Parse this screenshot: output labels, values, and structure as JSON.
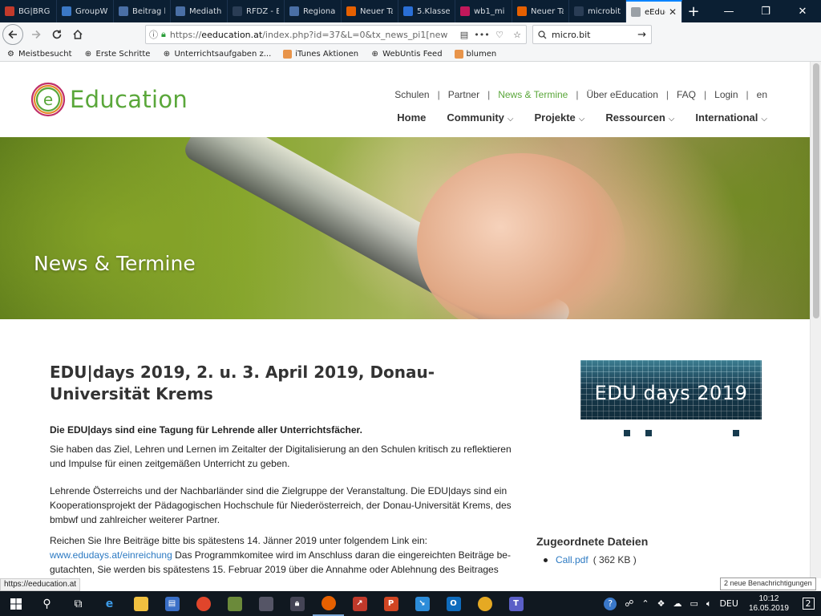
{
  "browser": {
    "tabs": [
      {
        "title": "BG|BRG V",
        "color": "#c23a2b"
      },
      {
        "title": "GroupW",
        "color": "#3b78c5"
      },
      {
        "title": "Beitrag b",
        "color": "#4a6fa5"
      },
      {
        "title": "Mediath",
        "color": "#4a6fa5"
      },
      {
        "title": "RFDZ - B",
        "color": "#2a3d55"
      },
      {
        "title": "Regional",
        "color": "#4a6fa5"
      },
      {
        "title": "Neuer Ta",
        "color": "#e66000"
      },
      {
        "title": "5.Klasse",
        "color": "#2a6fd6"
      },
      {
        "title": "wb1_mi",
        "color": "#c2185b"
      },
      {
        "title": "Neuer Ta",
        "color": "#e66000"
      },
      {
        "title": "microbit - Da",
        "color": "#2a3d55"
      },
      {
        "title": "eEduc",
        "color": "#9aa0a6"
      }
    ],
    "new_tab": "+",
    "window_controls": [
      "—",
      "❐",
      "✕"
    ],
    "url_prefix": "https://",
    "url_host": "eeducation.at",
    "url_path": "/index.php?id=37&L=0&tx_news_pi1[new",
    "search_value": "micro.bit",
    "bookmarks": [
      {
        "label": "Meistbesucht",
        "icon": "gear-icon"
      },
      {
        "label": "Erste Schritte",
        "icon": "globe-icon"
      },
      {
        "label": "Unterrichtsaufgaben z...",
        "icon": "globe-icon"
      },
      {
        "label": "iTunes Aktionen",
        "icon": "folder-icon"
      },
      {
        "label": "WebUntis Feed",
        "icon": "globe-icon"
      },
      {
        "label": "blumen",
        "icon": "folder-icon"
      }
    ]
  },
  "site": {
    "logo_text": "Education",
    "top_nav": [
      "Schulen",
      "Partner",
      "News & Termine",
      "Über eEducation",
      "FAQ",
      "Login",
      "en"
    ],
    "main_nav": [
      "Home",
      "Community",
      "Projekte",
      "Ressourcen",
      "International"
    ],
    "hero_title": "News & Termine"
  },
  "article": {
    "title": "EDU|days 2019, 2. u. 3. April 2019, Donau-Universität Krems",
    "lead": "Die EDU|days sind eine Tagung für Lehrende aller Unterrichtsfächer.",
    "p1": "Sie haben das Ziel, Lehren und Lernen im Zeitalter der Digitalisierung an den Schulen kritisch zu reflektieren und Impulse für einen zeitgemäßen Unterricht zu geben.",
    "p2": "Lehrende Österreichs und der Nachbarländer sind die Zielgruppe der Veranstaltung. Die EDU|days sind ein Kooperationsprojekt der Pädagogischen Hochschule für Niederösterreich, der Donau-Universität Krems, des bmbwf und zahlreicher weiterer Partner.",
    "p3_before": "Reichen Sie Ihre Beiträge bitte bis spätestens 14. Jänner 2019 unter folgendem Link ein:",
    "p3_link": "www.edudays.at/einreichung",
    "p3_after": " Das Programmkomitee wird im Anschluss daran die eingereichten Beiträge be-gutachten, Sie werden bis spätestens 15. Februar 2019 über die Annahme oder Ablehnung des Beitrages infor-"
  },
  "sidebar": {
    "banner_text": "EDU days 2019",
    "files_heading": "Zugeordnete Dateien",
    "files": [
      {
        "name": "Call.pdf",
        "size": "( 362 KB )"
      }
    ]
  },
  "status": {
    "hover_url": "https://eeducation.at",
    "notification_tip": "2 neue Benachrichtigungen"
  },
  "taskbar": {
    "time": "10:12",
    "date": "16.05.2019",
    "lang": "DEU",
    "notifications": "2"
  },
  "colors": {
    "brand_green": "#5aa73a",
    "link_blue": "#2b79c2",
    "taskbar": "#101820"
  }
}
